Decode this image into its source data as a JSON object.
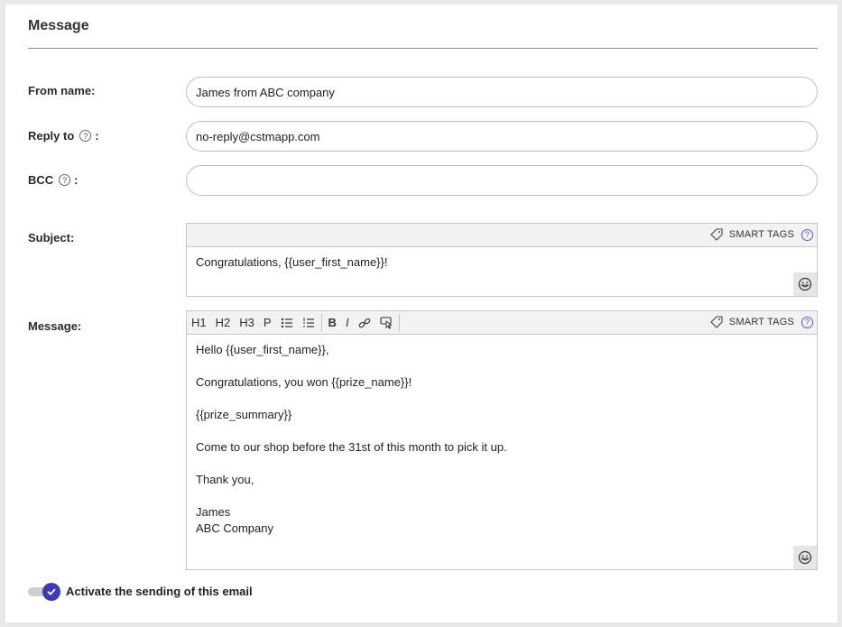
{
  "section": {
    "title": "Message"
  },
  "fields": {
    "from_name": {
      "label": "From name:",
      "value": "James from ABC company"
    },
    "reply_to": {
      "label": "Reply to",
      "colon": ":",
      "value": "no-reply@cstmapp.com"
    },
    "bcc": {
      "label": "BCC",
      "colon": ":",
      "value": ""
    },
    "subject": {
      "label": "Subject:"
    },
    "message": {
      "label": "Message:"
    }
  },
  "help_glyph": "?",
  "smart_tags_label": "SMART TAGS",
  "subject_editor": {
    "text": "Congratulations, {{user_first_name}}!"
  },
  "message_editor": {
    "toolbar": {
      "h1": "H1",
      "h2": "H2",
      "h3": "H3",
      "p": "P",
      "bold": "B",
      "italic": "I"
    },
    "lines": [
      "Hello {{user_first_name}},",
      "",
      "Congratulations, you won {{prize_name}}!",
      "",
      "{{prize_summary}}",
      "",
      "Come to our shop before the 31st of this month to pick it up.",
      "",
      "Thank you,",
      "",
      "James",
      "ABC Company"
    ]
  },
  "activate": {
    "label": "Activate the sending of this email",
    "checked": true
  },
  "colors": {
    "accent": "#3b3bb8",
    "help": "#5a5ac8"
  }
}
